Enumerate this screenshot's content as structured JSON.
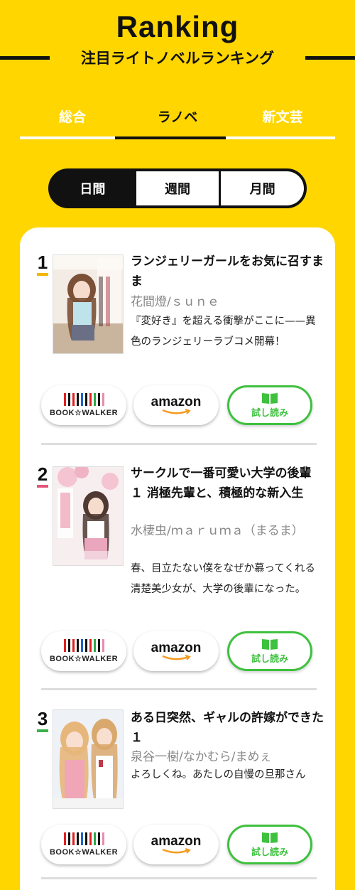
{
  "header": {
    "title": "Ranking",
    "subtitle": "注目ライトノベルランキング"
  },
  "tabs": [
    {
      "label": "総合",
      "active": false
    },
    {
      "label": "ラノベ",
      "active": true
    },
    {
      "label": "新文芸",
      "active": false
    }
  ],
  "period": [
    "日間",
    "週間",
    "月間"
  ],
  "buttons": {
    "bookwalker": "BOOK☆WALKER",
    "amazon": "amazon",
    "trial": "試し読み"
  },
  "colors": {
    "background": "#FFD600",
    "trial_green": "#3EC13E",
    "rank1": "#F2B705",
    "rank2": "#E3557A",
    "rank3": "#3DB04A"
  },
  "items": [
    {
      "rank": "1",
      "title": "ランジェリーガールをお気に召すまま",
      "author": "花間燈/ｓｕｎｅ",
      "description": "『変好き』を超える衝撃がここに——異色のランジェリーラブコメ開幕！"
    },
    {
      "rank": "2",
      "title": "サークルで一番可愛い大学の後輩 １ 消極先輩と、積極的な新入生",
      "author": "水棲虫/ｍａｒｕｍａ（まるま）",
      "description": "春、目立たない僕をなぜか慕ってくれる清楚美少女が、大学の後輩になった。"
    },
    {
      "rank": "3",
      "title": "ある日突然、ギャルの許嫁ができた １",
      "author": "泉谷一樹/なかむら/まめぇ",
      "description": "よろしくね。あたしの自慢の旦那さん"
    }
  ]
}
